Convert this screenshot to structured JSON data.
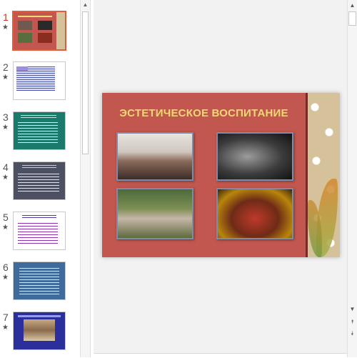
{
  "thumbnails": [
    {
      "number": "1",
      "selected": true
    },
    {
      "number": "2",
      "selected": false
    },
    {
      "number": "3",
      "selected": false
    },
    {
      "number": "4",
      "selected": false
    },
    {
      "number": "5",
      "selected": false
    },
    {
      "number": "6",
      "selected": false
    },
    {
      "number": "7",
      "selected": false
    }
  ],
  "thumb_marker": "★",
  "slide": {
    "title": "ЭСТЕТИЧЕСКОЕ ВОСПИТАНИЕ"
  },
  "scrollbar": {
    "up": "▲",
    "down": "▼",
    "prev_slide": "⯭",
    "next_slide": "⯯"
  },
  "colors": {
    "accent": "#e35b3d",
    "slide_bg": "#c1574e",
    "title_color": "#f0d873"
  }
}
